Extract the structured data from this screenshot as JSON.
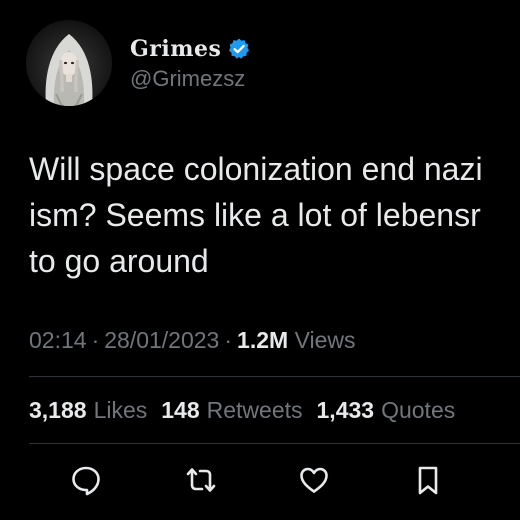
{
  "author": {
    "display_name": "Grimes",
    "handle": "@Grimezsz",
    "verified": true,
    "avatar_icon": "avatar-hooded-figure-icon",
    "verified_color": "#1d9bf0"
  },
  "tweet": {
    "text_lines": [
      "Will space colonization end nazi",
      "ism?  Seems like a lot of lebensr",
      "to go around"
    ]
  },
  "meta": {
    "time": "02:14",
    "separator": "·",
    "date": "28/01/2023",
    "views_count": "1.2M",
    "views_label": "Views"
  },
  "stats": {
    "likes": {
      "count": "3,188",
      "label": "Likes"
    },
    "retweets": {
      "count": "148",
      "label": "Retweets"
    },
    "quotes": {
      "count": "1,433",
      "label": "Quotes"
    }
  },
  "actions": [
    {
      "name": "reply",
      "icon": "speech-bubble-icon"
    },
    {
      "name": "retweet",
      "icon": "retweet-arrows-icon"
    },
    {
      "name": "like",
      "icon": "heart-icon"
    },
    {
      "name": "bookmark",
      "icon": "bookmark-icon"
    }
  ],
  "colors": {
    "background": "#000000",
    "text_primary": "#e7e9ea",
    "text_secondary": "#71767b",
    "divider": "#2f3336"
  }
}
